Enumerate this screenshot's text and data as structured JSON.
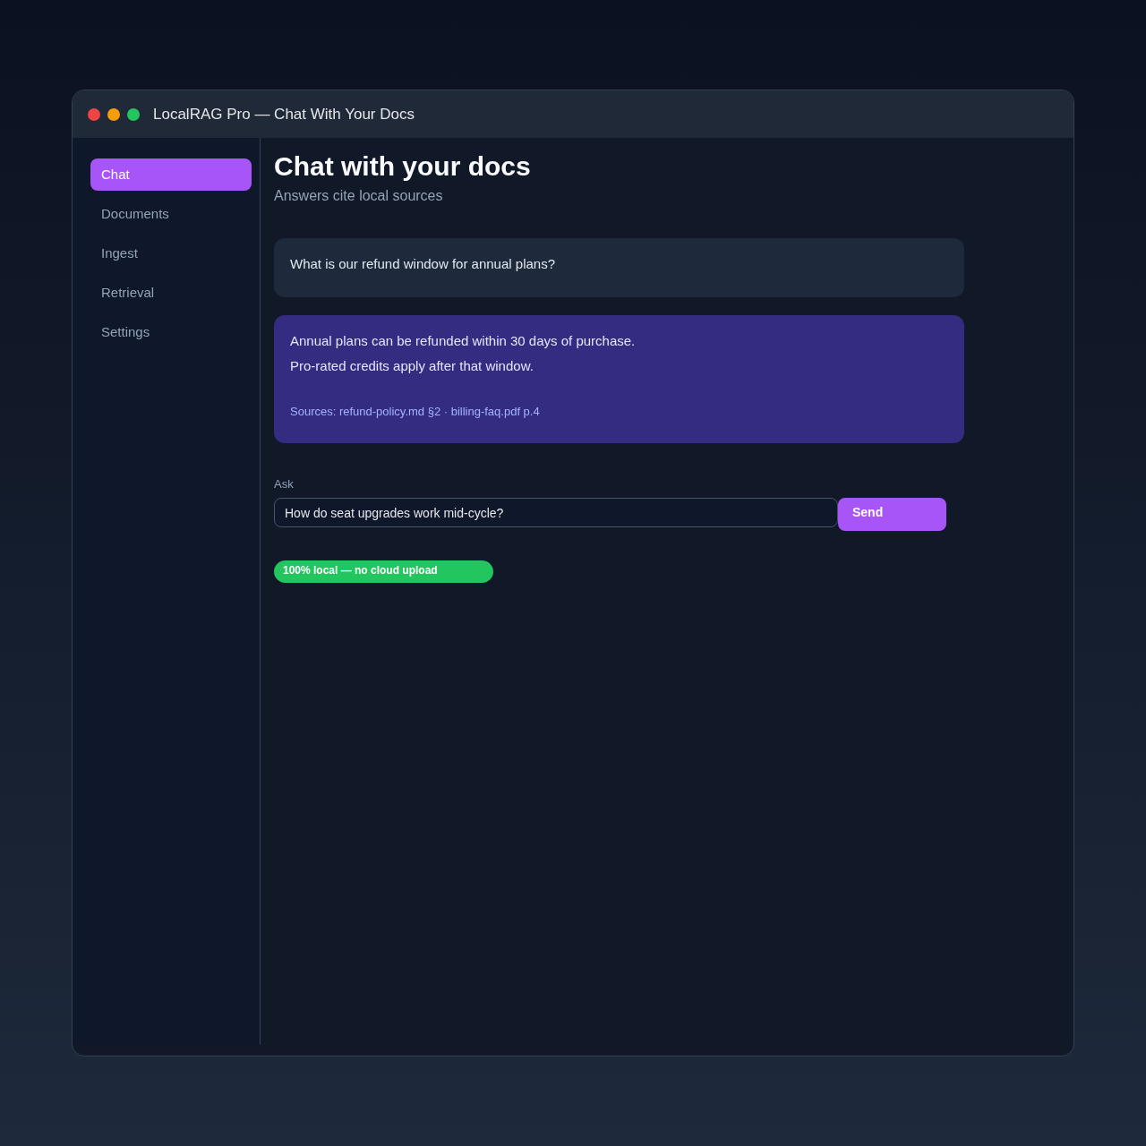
{
  "window": {
    "title": "LocalRAG Pro — Chat With Your Docs",
    "controls": [
      {
        "color": "#ef4444"
      },
      {
        "color": "#f59e0b"
      },
      {
        "color": "#22c55e"
      }
    ]
  },
  "sidebar": {
    "items": [
      {
        "label": "Chat",
        "selected": true
      },
      {
        "label": "Documents",
        "selected": false
      },
      {
        "label": "Ingest",
        "selected": false
      },
      {
        "label": "Retrieval",
        "selected": false
      },
      {
        "label": "Settings",
        "selected": false
      }
    ]
  },
  "header": {
    "title": "Chat with your docs",
    "subtitle": "Answers cite local sources"
  },
  "messages": [
    {
      "kind": "user",
      "lines": [
        "What is our refund window for annual plans?"
      ]
    },
    {
      "kind": "assistant",
      "lines": [
        "Annual plans can be refunded within 30 days of purchase.",
        "Pro-rated credits apply after that window."
      ],
      "sources": "Sources: refund-policy.md §2 · billing-faq.pdf p.4"
    }
  ],
  "ask": {
    "label": "Ask",
    "value": "How do seat upgrades work mid-cycle?",
    "button": "Send"
  },
  "badge": "100% local — no cloud upload"
}
